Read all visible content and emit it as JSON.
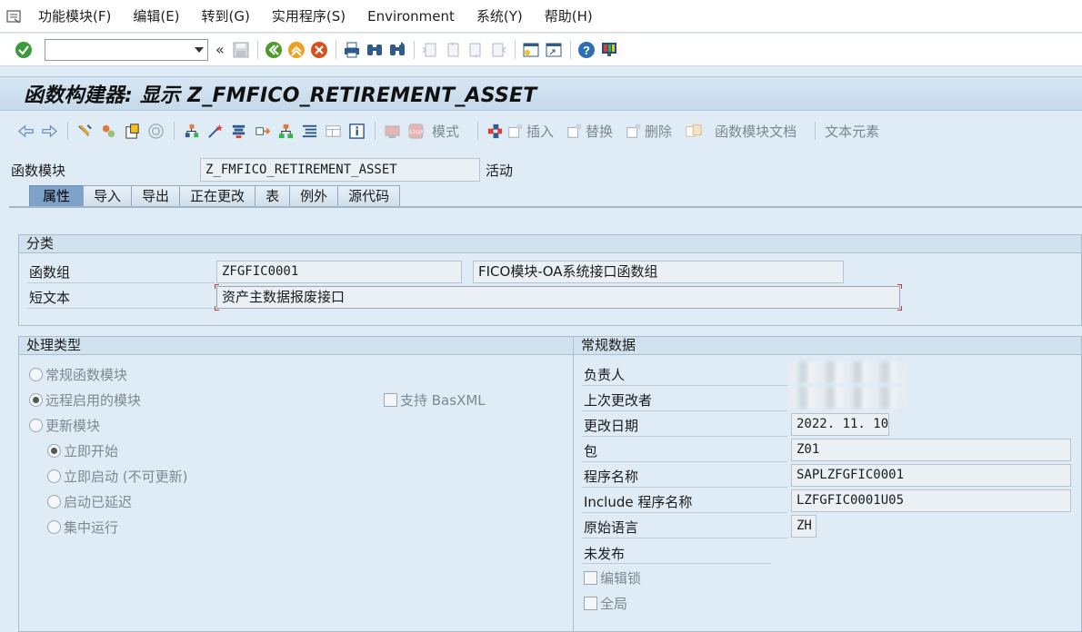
{
  "menubar": {
    "items": [
      "功能模块(F)",
      "编辑(E)",
      "转到(G)",
      "实用程序(S)",
      "Environment",
      "系统(Y)",
      "帮助(H)"
    ]
  },
  "toolbar": {
    "command_value": "",
    "icons": [
      "enter-icon",
      "back-icon",
      "exit-icon",
      "cancel-icon",
      "print-icon",
      "find-icon",
      "find-next-icon",
      "first-page-icon",
      "previous-page-icon",
      "next-page-icon",
      "last-page-icon",
      "new-session-icon",
      "shortcut-icon",
      "help-icon",
      "customize-layout-icon"
    ]
  },
  "title": "函数构建器: 显示 Z_FMFICO_RETIREMENT_ASSET",
  "app_toolbar": {
    "mode_label": "模式",
    "insert_label": "插入",
    "replace_label": "替换",
    "delete_label": "删除",
    "doc_label": "函数模块文档",
    "text_elements_label": "文本元素"
  },
  "header": {
    "label": "函数模块",
    "value": "Z_FMFICO_RETIREMENT_ASSET",
    "status": "活动"
  },
  "tabs": [
    "属性",
    "导入",
    "导出",
    "正在更改",
    "表",
    "例外",
    "源代码"
  ],
  "active_tab": "属性",
  "classification": {
    "title": "分类",
    "function_group_label": "函数组",
    "function_group_value": "ZFGFIC0001",
    "function_group_desc": "FICO模块-OA系统接口函数组",
    "short_text_label": "短文本",
    "short_text_value": "资产主数据报废接口"
  },
  "processing": {
    "title": "处理类型",
    "normal": "常规函数模块",
    "remote": "远程启用的模块",
    "basxml": "支持 BasXML",
    "update": "更新模块",
    "immediate_start": "立即开始",
    "immediate_no_update": "立即启动 (不可更新)",
    "delayed": "启动已延迟",
    "collective": "集中运行",
    "selected": "remote",
    "update_selected": "immediate_start"
  },
  "general": {
    "title": "常规数据",
    "owner_label": "负责人",
    "last_changed_by_label": "上次更改者",
    "changed_on_label": "更改日期",
    "changed_on_value": "2022. 11. 10",
    "package_label": "包",
    "package_value": "Z01",
    "program_label": "程序名称",
    "program_value": "SAPLZFGFIC0001",
    "include_label": "Include 程序名称",
    "include_value": "LZFGFIC0001U05",
    "language_label": "原始语言",
    "language_value": "ZH",
    "unreleased_label": "未发布",
    "edit_lock_label": "编辑锁",
    "global_label": "全局"
  }
}
